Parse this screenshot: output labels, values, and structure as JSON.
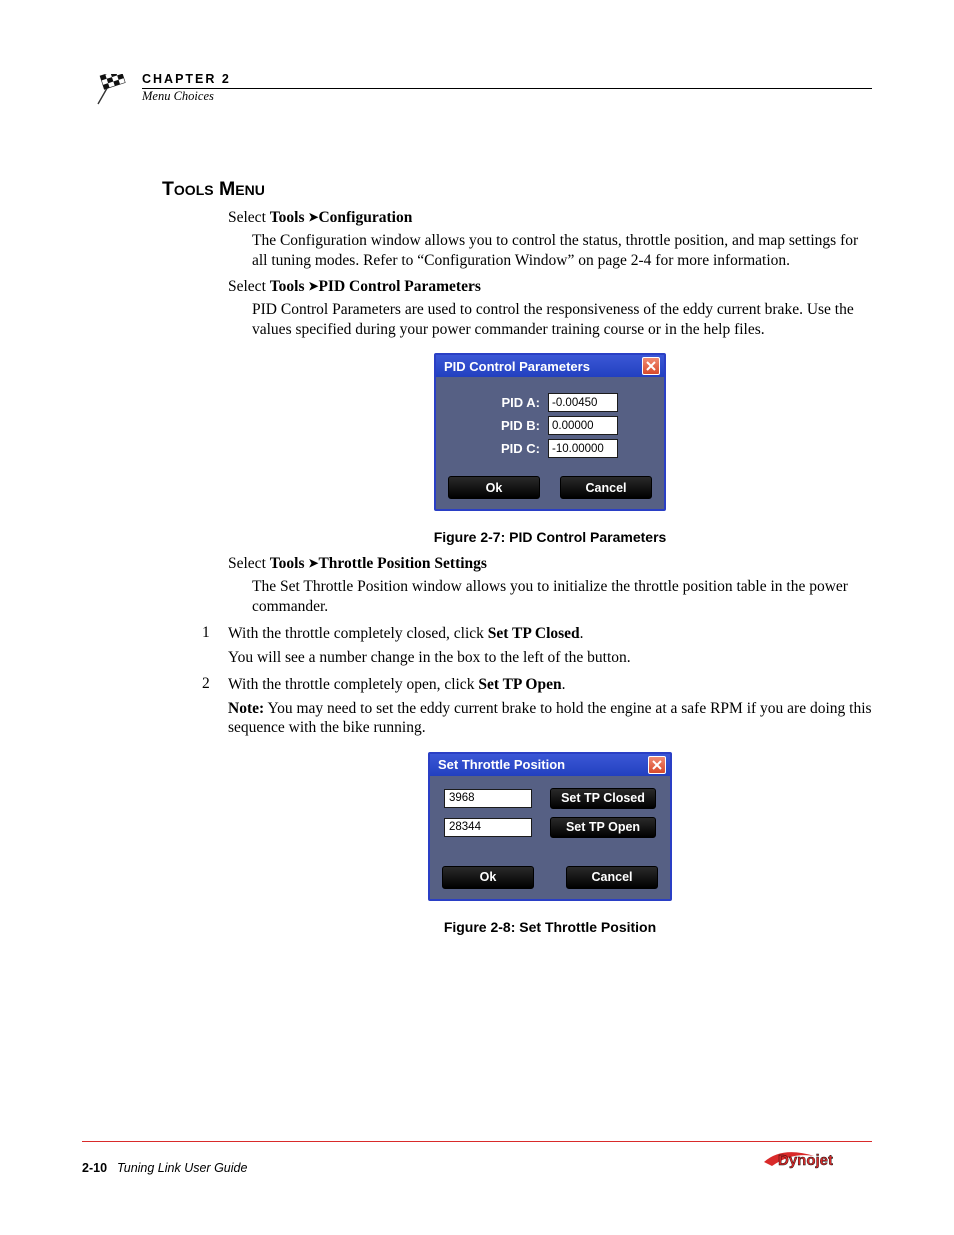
{
  "header": {
    "chapter": "CHAPTER 2",
    "section": "Menu Choices"
  },
  "section_title": "Tools Menu",
  "items": [
    {
      "select_prefix": "Select ",
      "select_bold1": "Tools",
      "select_bold2": "Configuration",
      "para": "The Configuration window allows you to control the status, throttle position, and map settings for all tuning modes. Refer to “Configuration Window” on page 2-4 for more information."
    },
    {
      "select_prefix": "Select ",
      "select_bold1": "Tools",
      "select_bold2": "PID Control Parameters",
      "para": "PID Control Parameters are used to control the responsiveness of the eddy current brake. Use the values specified during your power commander training course or in the help files."
    },
    {
      "select_prefix": "Select ",
      "select_bold1": "Tools",
      "select_bold2": "Throttle Position Settings",
      "para": "The Set Throttle Position window allows you to initialize the throttle position table in the power commander."
    }
  ],
  "pid_dialog": {
    "title": "PID Control Parameters",
    "rows": [
      {
        "label": "PID A:",
        "value": "-0.00450"
      },
      {
        "label": "PID B:",
        "value": "0.00000"
      },
      {
        "label": "PID C:",
        "value": "-10.00000"
      }
    ],
    "ok": "Ok",
    "cancel": "Cancel"
  },
  "pid_caption": "Figure 2-7: PID Control Parameters",
  "steps": [
    {
      "num": "1",
      "text_before": "With the throttle completely closed, click ",
      "bold": "Set TP Closed",
      "text_after": ".",
      "follow": "You will see a number change in the box to the left of the button."
    },
    {
      "num": "2",
      "text_before": "With the throttle completely open, click ",
      "bold": "Set TP Open",
      "text_after": ".",
      "note_label": "Note:",
      "note": " You may need to set the eddy current brake to hold the engine at a safe RPM if you are doing this sequence with the bike running."
    }
  ],
  "tp_dialog": {
    "title": "Set Throttle Position",
    "rows": [
      {
        "value": "3968",
        "btn": "Set TP Closed"
      },
      {
        "value": "28344",
        "btn": "Set TP Open"
      }
    ],
    "ok": "Ok",
    "cancel": "Cancel"
  },
  "tp_caption": "Figure 2-8: Set Throttle Position",
  "footer": {
    "page": "2-10",
    "guide": "Tuning Link User Guide",
    "brand": "Dynojet"
  }
}
